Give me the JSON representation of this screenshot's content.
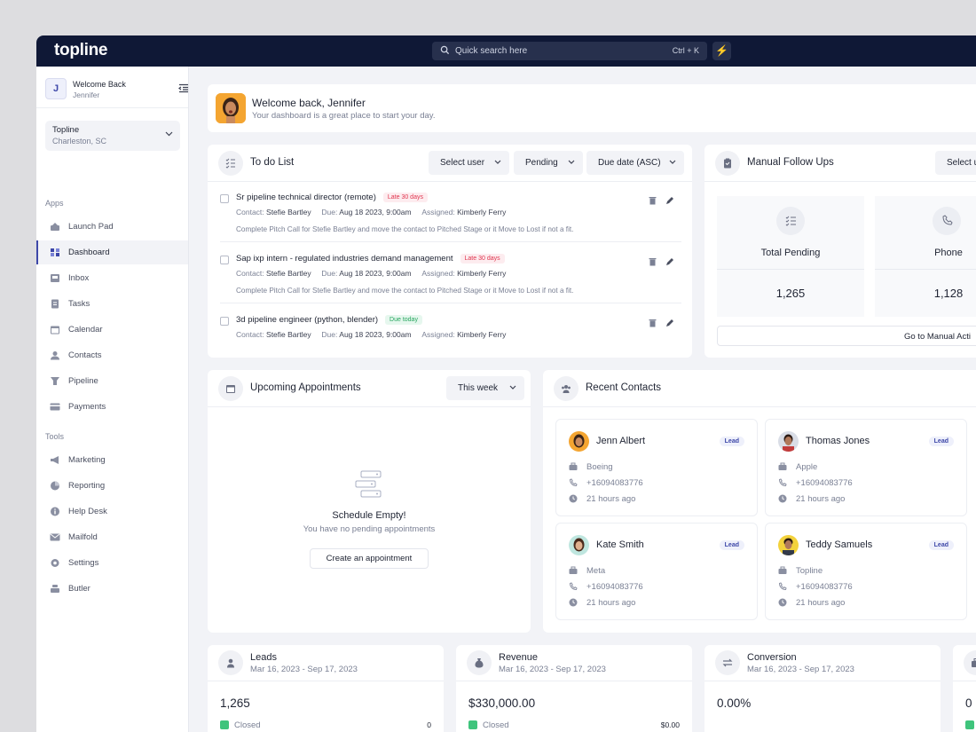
{
  "brand": {
    "logo": "topline"
  },
  "search": {
    "placeholder": "Quick search here",
    "shortcut": "Ctrl + K"
  },
  "user": {
    "initial": "J",
    "greeting": "Welcome Back",
    "name": "Jennifer"
  },
  "location": {
    "name": "Topline",
    "city": "Charleston, SC"
  },
  "sidebar": {
    "apps_label": "Apps",
    "apps": [
      {
        "label": "Launch Pad",
        "icon": "rocket-icon"
      },
      {
        "label": "Dashboard",
        "icon": "grid-icon",
        "active": true
      },
      {
        "label": "Inbox",
        "icon": "inbox-icon"
      },
      {
        "label": "Tasks",
        "icon": "tasks-icon"
      },
      {
        "label": "Calendar",
        "icon": "calendar-icon"
      },
      {
        "label": "Contacts",
        "icon": "contacts-icon"
      },
      {
        "label": "Pipeline",
        "icon": "pipeline-icon"
      },
      {
        "label": "Payments",
        "icon": "card-icon"
      }
    ],
    "tools_label": "Tools",
    "tools": [
      {
        "label": "Marketing",
        "icon": "megaphone-icon"
      },
      {
        "label": "Reporting",
        "icon": "pie-icon"
      },
      {
        "label": "Help Desk",
        "icon": "info-icon"
      },
      {
        "label": "Mailfold",
        "icon": "mail-icon"
      },
      {
        "label": "Settings",
        "icon": "gear-icon"
      },
      {
        "label": "Butler",
        "icon": "butler-icon"
      }
    ]
  },
  "welcome": {
    "title": "Welcome back, Jennifer",
    "subtitle": "Your dashboard is a great place to start your day."
  },
  "todo": {
    "title": "To do List",
    "filters": [
      "Select user",
      "Pending",
      "Due date (ASC)"
    ],
    "items": [
      {
        "name": "Sr pipeline technical director (remote)",
        "tag": "Late 30 days",
        "contact_label": "Contact:",
        "contact": "Stefie Bartley",
        "due_label": "Due:",
        "due": "Aug 18 2023, 9:00am",
        "assigned_label": "Assigned:",
        "assigned": "Kimberly Ferry",
        "desc": "Complete Pitch Call for Stefie Bartley and move the contact to Pitched Stage or it Move to Lost if not a fit."
      },
      {
        "name": "Sap ixp intern - regulated industries demand management",
        "tag": "Late 30 days",
        "contact_label": "Contact:",
        "contact": "Stefie Bartley",
        "due_label": "Due:",
        "due": "Aug 18 2023, 9:00am",
        "assigned_label": "Assigned:",
        "assigned": "Kimberly Ferry",
        "desc": "Complete Pitch Call for Stefie Bartley and move the contact to Pitched Stage or it Move to Lost if not a fit."
      },
      {
        "name": "3d pipeline engineer (python, blender)",
        "tag": "Due today",
        "contact_label": "Contact:",
        "contact": "Stefie Bartley",
        "due_label": "Due:",
        "due": "Aug 18 2023, 9:00am",
        "assigned_label": "Assigned:",
        "assigned": "Kimberly Ferry",
        "desc": ""
      }
    ]
  },
  "followups": {
    "title": "Manual Follow Ups",
    "select": "Select u",
    "stats": [
      {
        "label": "Total Pending",
        "value": "1,265",
        "icon": "list-icon"
      },
      {
        "label": "Phone",
        "value": "1,128",
        "icon": "phone-icon"
      }
    ],
    "button": "Go to Manual Acti"
  },
  "appointments": {
    "title": "Upcoming Appointments",
    "filter": "This week",
    "empty_title": "Schedule Empty!",
    "empty_sub": "You have no pending appointments",
    "button": "Create an appointment"
  },
  "recent": {
    "title": "Recent Contacts",
    "contacts": [
      {
        "name": "Jenn Albert",
        "badge": "Lead",
        "company": "Boeing",
        "phone": "+16094083776",
        "time": "21 hours ago"
      },
      {
        "name": "Thomas Jones",
        "badge": "Lead",
        "company": "Apple",
        "phone": "+16094083776",
        "time": "21 hours ago"
      },
      {
        "name": "Kate Smith",
        "badge": "Lead",
        "company": "Meta",
        "phone": "+16094083776",
        "time": "21 hours ago"
      },
      {
        "name": "Teddy Samuels",
        "badge": "Lead",
        "company": "Topline",
        "phone": "+16094083776",
        "time": "21 hours ago"
      }
    ]
  },
  "stats": [
    {
      "title": "Leads",
      "range": "Mar 16, 2023 - Sep 17, 2023",
      "value": "1,265",
      "closed_label": "Closed",
      "closed_value": "0"
    },
    {
      "title": "Revenue",
      "range": "Mar 16, 2023 - Sep 17, 2023",
      "value": "$330,000.00",
      "closed_label": "Closed",
      "closed_value": "$0.00"
    },
    {
      "title": "Conversion",
      "range": "Mar 16, 2023 - Sep 17, 2023",
      "value": "0.00%",
      "closed_label": "",
      "closed_value": ""
    },
    {
      "title": "",
      "range": "",
      "value": "0",
      "closed_label": "",
      "closed_value": ""
    }
  ],
  "colors": {
    "topbar": "#0f1836",
    "accent": "#3d47a8",
    "late": "#e0364f",
    "today": "#25a55d",
    "closed": "#3fc47c"
  }
}
